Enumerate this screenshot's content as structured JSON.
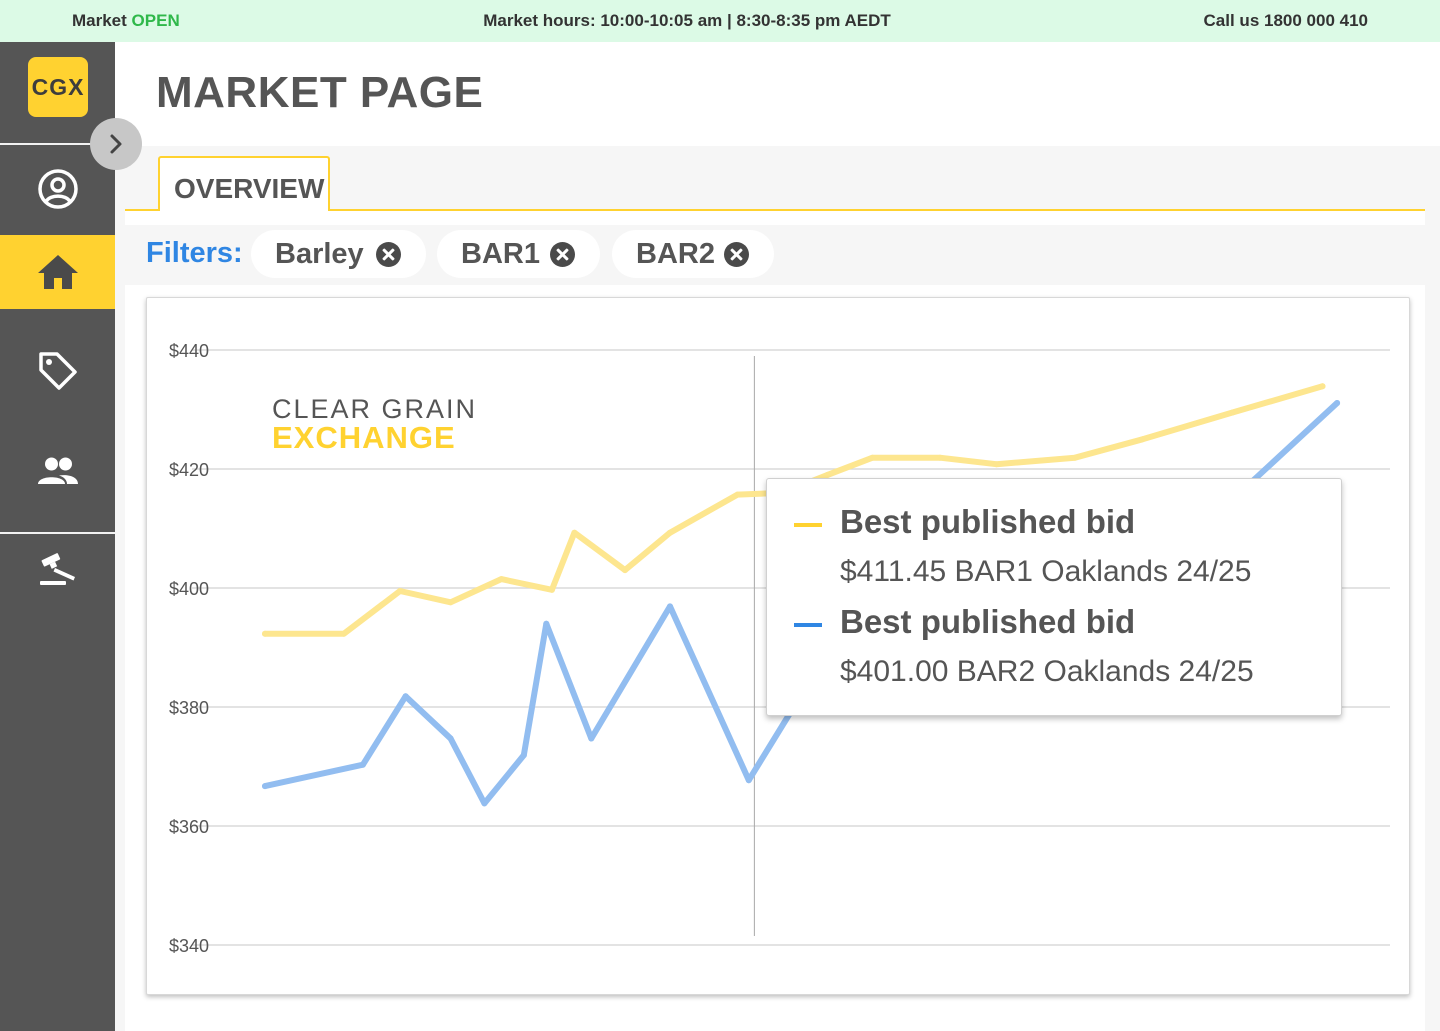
{
  "topbar": {
    "market_label": "Market",
    "market_status": "OPEN",
    "market_hours": "Market hours: 10:00-10:05 am | 8:30-8:35 pm AEDT",
    "call_us": "Call us 1800 000 410"
  },
  "sidebar": {
    "logo_text": "CGX",
    "items": [
      {
        "icon": "account-circle-icon",
        "active": false
      },
      {
        "icon": "home-icon",
        "active": true
      },
      {
        "icon": "tag-icon",
        "active": false
      },
      {
        "icon": "people-icon",
        "active": false
      },
      {
        "icon": "gavel-icon",
        "active": false
      }
    ],
    "collapse_icon": "chevron-right-icon"
  },
  "page": {
    "title": "MARKET PAGE",
    "tabs": [
      {
        "label": "OVERVIEW",
        "active": true
      }
    ]
  },
  "filters": {
    "label": "Filters:",
    "chips": [
      {
        "label": "Barley"
      },
      {
        "label": "BAR1"
      },
      {
        "label": "BAR2"
      }
    ]
  },
  "watermark": {
    "line1": "CLEAR GRAIN",
    "line2": "EXCHANGE"
  },
  "colors": {
    "accent_yellow": "#ffd230",
    "accent_blue": "#2f86e3",
    "bar1_line": "#fde68f",
    "bar2_line": "#92bdf0",
    "market_open_green": "#2fb84a"
  },
  "chart_data": {
    "type": "line",
    "ylim": [
      340,
      440
    ],
    "yticks": [
      340,
      360,
      380,
      400,
      420,
      440
    ],
    "ytick_labels": [
      "$340",
      "$360",
      "$380",
      "$400",
      "$420",
      "$440"
    ],
    "grid": true,
    "series": [
      {
        "name": "BAR1",
        "color": "#fde68f",
        "points": [
          [
            0,
            392.3
          ],
          [
            0.07,
            392.3
          ],
          [
            0.12,
            399.5
          ],
          [
            0.165,
            397.6
          ],
          [
            0.21,
            401.5
          ],
          [
            0.255,
            399.7
          ],
          [
            0.275,
            409.3
          ],
          [
            0.32,
            403.0
          ],
          [
            0.36,
            409.3
          ],
          [
            0.42,
            415.7
          ],
          [
            0.46,
            416
          ],
          [
            0.5,
            419
          ],
          [
            0.54,
            421.9
          ],
          [
            0.6,
            421.9
          ],
          [
            0.65,
            420.8
          ],
          [
            0.72,
            421.9
          ],
          [
            0.78,
            425.0
          ],
          [
            0.86,
            429.5
          ],
          [
            0.94,
            433.9
          ]
        ]
      },
      {
        "name": "BAR2",
        "color": "#92bdf0",
        "points": [
          [
            0,
            366.7
          ],
          [
            0.087,
            370.3
          ],
          [
            0.125,
            381.8
          ],
          [
            0.165,
            374.7
          ],
          [
            0.195,
            363.8
          ],
          [
            0.23,
            371.9
          ],
          [
            0.25,
            394.0
          ],
          [
            0.29,
            374.7
          ],
          [
            0.36,
            396.9
          ],
          [
            0.43,
            367.7
          ],
          [
            0.47,
            380.0
          ],
          [
            0.5,
            390.0
          ],
          [
            0.55,
            400.0
          ],
          [
            0.6,
            404.0
          ],
          [
            0.65,
            407.0
          ],
          [
            0.72,
            410.0
          ],
          [
            0.8,
            415.0
          ],
          [
            0.87,
            416.6
          ],
          [
            0.953,
            431.1
          ]
        ]
      }
    ],
    "crosshair_x": 0.435,
    "tooltip": {
      "entries": [
        {
          "name": "Best published bid",
          "value": "$411.45 BAR1 Oaklands 24/25",
          "color": "#ffd230"
        },
        {
          "name": "Best published bid",
          "value": "$401.00 BAR2 Oaklands 24/25",
          "color": "#2f86e3"
        }
      ]
    }
  }
}
